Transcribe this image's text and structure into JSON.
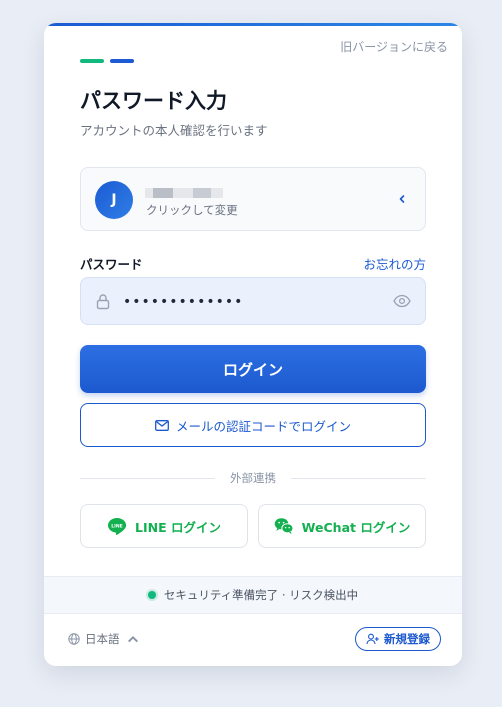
{
  "header": {
    "old_version_link": "旧バージョンに戻る",
    "title": "パスワード入力",
    "subtitle": "アカウントの本人確認を行います"
  },
  "account": {
    "avatar_initial": "J",
    "hint": "クリックして変更"
  },
  "password": {
    "label": "パスワード",
    "forgot_link": "お忘れの方",
    "value": "•••••••••••••"
  },
  "buttons": {
    "login": "ログイン",
    "mail_login": "メールの認証コードでログイン"
  },
  "divider": {
    "label": "外部連携"
  },
  "social": {
    "line": "LINE ログイン",
    "wechat": "WeChat ログイン"
  },
  "status": {
    "text": "セキュリティ準備完了 · リスク検出中"
  },
  "footer": {
    "language": "日本語",
    "register": "新規登録"
  },
  "colors": {
    "brand_blue": "#1c59cf",
    "accent_green": "#12b97e",
    "social_green": "#12b04f"
  }
}
